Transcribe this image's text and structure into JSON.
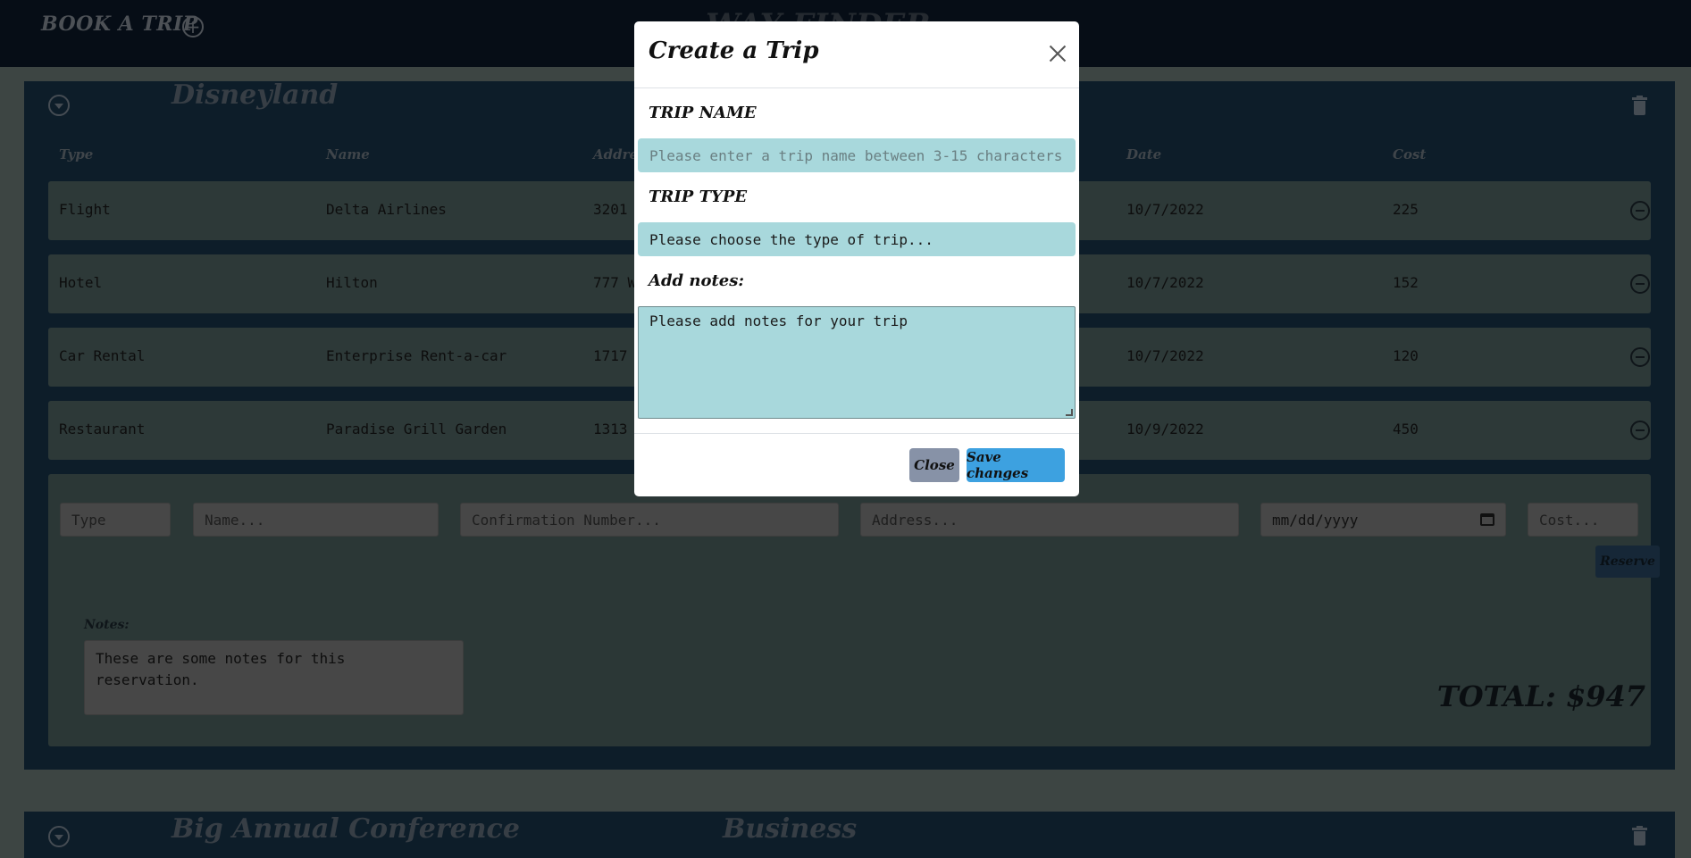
{
  "nav": {
    "book_trip_label": "BOOK A TRIP",
    "brand": "WAY FINDER"
  },
  "trip": {
    "title": "Disneyland",
    "columns": [
      "Type",
      "Name",
      "Address",
      "Date",
      "Cost"
    ],
    "reservations": [
      {
        "type": "Flight",
        "name": "Delta Airlines",
        "address": "3201",
        "date": "10/7/2022",
        "cost": "225"
      },
      {
        "type": "Hotel",
        "name": "Hilton",
        "address": "777 W",
        "date": "10/7/2022",
        "cost": "152"
      },
      {
        "type": "Car Rental",
        "name": "Enterprise Rent-a-car",
        "address": "1717",
        "date": "10/7/2022",
        "cost": "120"
      },
      {
        "type": "Restaurant",
        "name": "Paradise Grill Garden",
        "address": "1313",
        "date": "10/9/2022",
        "cost": "450"
      }
    ],
    "form": {
      "type_placeholder": "Type",
      "name_placeholder": "Name...",
      "confirmation_placeholder": "Confirmation Number...",
      "address_placeholder": "Address...",
      "date_placeholder": "mm/dd/yyyy",
      "cost_placeholder": "Cost...",
      "reserve_label": "Reserve",
      "notes_label": "Notes:",
      "notes_value": "These are some notes for this reservation."
    },
    "total": "TOTAL: $947"
  },
  "trip2": {
    "title": "Big Annual Conference",
    "type": "Business"
  },
  "modal": {
    "title": "Create a Trip",
    "trip_name_label": "TRIP NAME",
    "trip_name_placeholder": "Please enter a trip name between 3-15 characters",
    "trip_type_label": "TRIP TYPE",
    "trip_type_value": "Please choose the type of trip...",
    "notes_label": "Add notes:",
    "notes_value": "Please add notes for your trip",
    "close_label": "Close",
    "save_label": "Save changes"
  }
}
